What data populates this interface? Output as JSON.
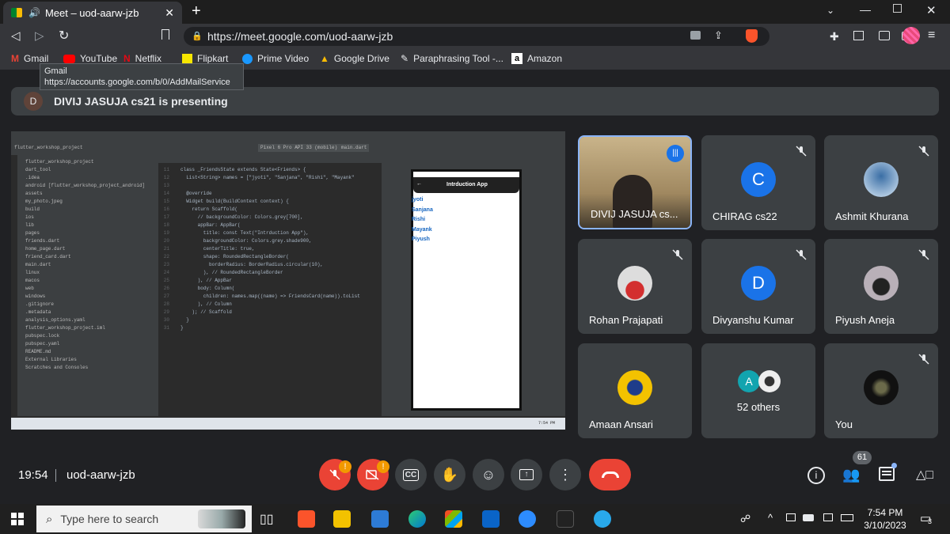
{
  "browser": {
    "tab_title": "Meet – uod-aarw-jzb",
    "url": "https://meet.google.com/uod-aarw-jzb",
    "bookmarks": [
      "Gmail",
      "YouTube",
      "Netflix",
      "Flipkart",
      "Prime Video",
      "Google Drive",
      "Paraphrasing Tool -...",
      "Amazon"
    ],
    "tooltip_title": "Gmail",
    "tooltip_url": "https://accounts.google.com/b/0/AddMailService"
  },
  "meet": {
    "presenter_initial": "D",
    "presenting_text": "DIVIJ JASUJA cs21 is presenting",
    "time": "19:54",
    "meeting_code": "uod-aarw-jzb",
    "people_count": "61",
    "participants": [
      {
        "name": "DIVIJ JASUJA cs...",
        "initial": ""
      },
      {
        "name": "CHIRAG cs22",
        "initial": "C"
      },
      {
        "name": "Ashmit Khurana",
        "initial": ""
      },
      {
        "name": "Rohan Prajapati",
        "initial": ""
      },
      {
        "name": "Divyanshu Kumar",
        "initial": "D"
      },
      {
        "name": "Piyush Aneja",
        "initial": ""
      },
      {
        "name": "Amaan Ansari",
        "initial": ""
      },
      {
        "name": "52 others",
        "initial": "A"
      },
      {
        "name": "You",
        "initial": ""
      }
    ]
  },
  "shared_screen": {
    "project_label": "flutter_workshop_project",
    "device": "Pixel 6 Pro API 33 (mobile)",
    "file": "main.dart",
    "tree": [
      "flutter_workshop_project",
      "dart_tool",
      ".idea",
      "android [flutter_workshop_project_android]",
      "assets",
      "my_photo.jpeg",
      "build",
      "ios",
      "lib",
      "pages",
      "friends.dart",
      "home_page.dart",
      "friend_card.dart",
      "main.dart",
      "linux",
      "macos",
      "web",
      "windows",
      ".gitignore",
      ".metadata",
      "analysis_options.yaml",
      "flutter_workshop_project.iml",
      "pubspec.lock",
      "pubspec.yaml",
      "README.md",
      "External Libraries",
      "Scratches and Consoles"
    ],
    "code_lines": [
      "class _FriendsState extends State<Friends> {",
      "  List<String> names = [\"jyoti\", \"Sanjana\", \"Rishi\", \"Mayank\"",
      "",
      "  @override",
      "  Widget build(BuildContext context) {",
      "    return Scaffold(",
      "      // backgroundColor: Colors.grey[700],",
      "      appBar: AppBar(",
      "        title: const Text(\"Intrduction App\"),",
      "        backgroundColor: Colors.grey.shade900,",
      "        centerTitle: true,",
      "        shape: RoundedRectangleBorder(",
      "          borderRadius: BorderRadius.circular(10),",
      "        ), // RoundedRectangleBorder",
      "      ), // AppBar",
      "      body: Column(",
      "        children: names.map((name) => FriendsCard(name)).toList",
      "      ), // Column",
      "    ); // Scaffold",
      "  }",
      "}"
    ],
    "line_numbers": [
      "11",
      "12",
      "13",
      "14",
      "15",
      "16",
      "17",
      "18",
      "19",
      "20",
      "21",
      "22",
      "23",
      "24",
      "25",
      "26",
      "27",
      "28",
      "29",
      "30",
      "31"
    ],
    "app_title": "Intrduction App",
    "app_names": [
      "jyoti",
      "Sanjana",
      "Rishi",
      "Mayank",
      "Piyush"
    ],
    "clock": "7:54 PM"
  },
  "taskbar": {
    "search_placeholder": "Type here to search",
    "time": "7:54 PM",
    "date": "3/10/2023"
  },
  "colors": {
    "end_call": "#ea4335",
    "accent": "#8ab4f8",
    "tile": "#3c4043",
    "avatar_blue": "#1a73e8"
  }
}
